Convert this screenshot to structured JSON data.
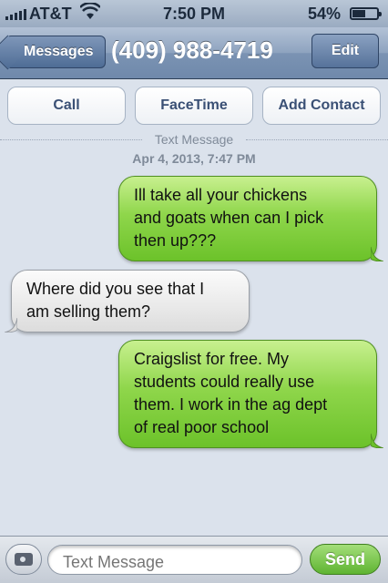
{
  "status_bar": {
    "carrier": "AT&T",
    "time": "7:50 PM",
    "battery_percent": "54%",
    "battery_level": 0.54,
    "icons": [
      "signal-icon",
      "wifi-icon",
      "battery-icon"
    ]
  },
  "nav": {
    "back_label": "Messages",
    "title": "(409) 988-4719",
    "edit_label": "Edit"
  },
  "actions": {
    "call": "Call",
    "facetime": "FaceTime",
    "add_contact": "Add Contact"
  },
  "conversation": {
    "divider_label": "Text Message",
    "timestamp": "Apr 4, 2013, 7:47 PM",
    "messages": [
      {
        "direction": "sent",
        "lines": [
          "Ill take all your chickens",
          "and goats when can I pick",
          "then up???"
        ]
      },
      {
        "direction": "received",
        "lines": [
          "Where did you see that I",
          "am selling them?"
        ]
      },
      {
        "direction": "sent",
        "lines": [
          "Craigslist for free. My",
          "students could really use",
          "them. I work in the ag dept",
          "of real poor school"
        ]
      }
    ]
  },
  "composer": {
    "placeholder": "Text Message",
    "send_label": "Send",
    "camera_icon": "camera-icon"
  },
  "colors": {
    "sent_bubble": "#8fd64b",
    "received_bubble": "#e9e9e9",
    "background": "#dbe2ec",
    "nav_bar": "#7b93b3"
  }
}
